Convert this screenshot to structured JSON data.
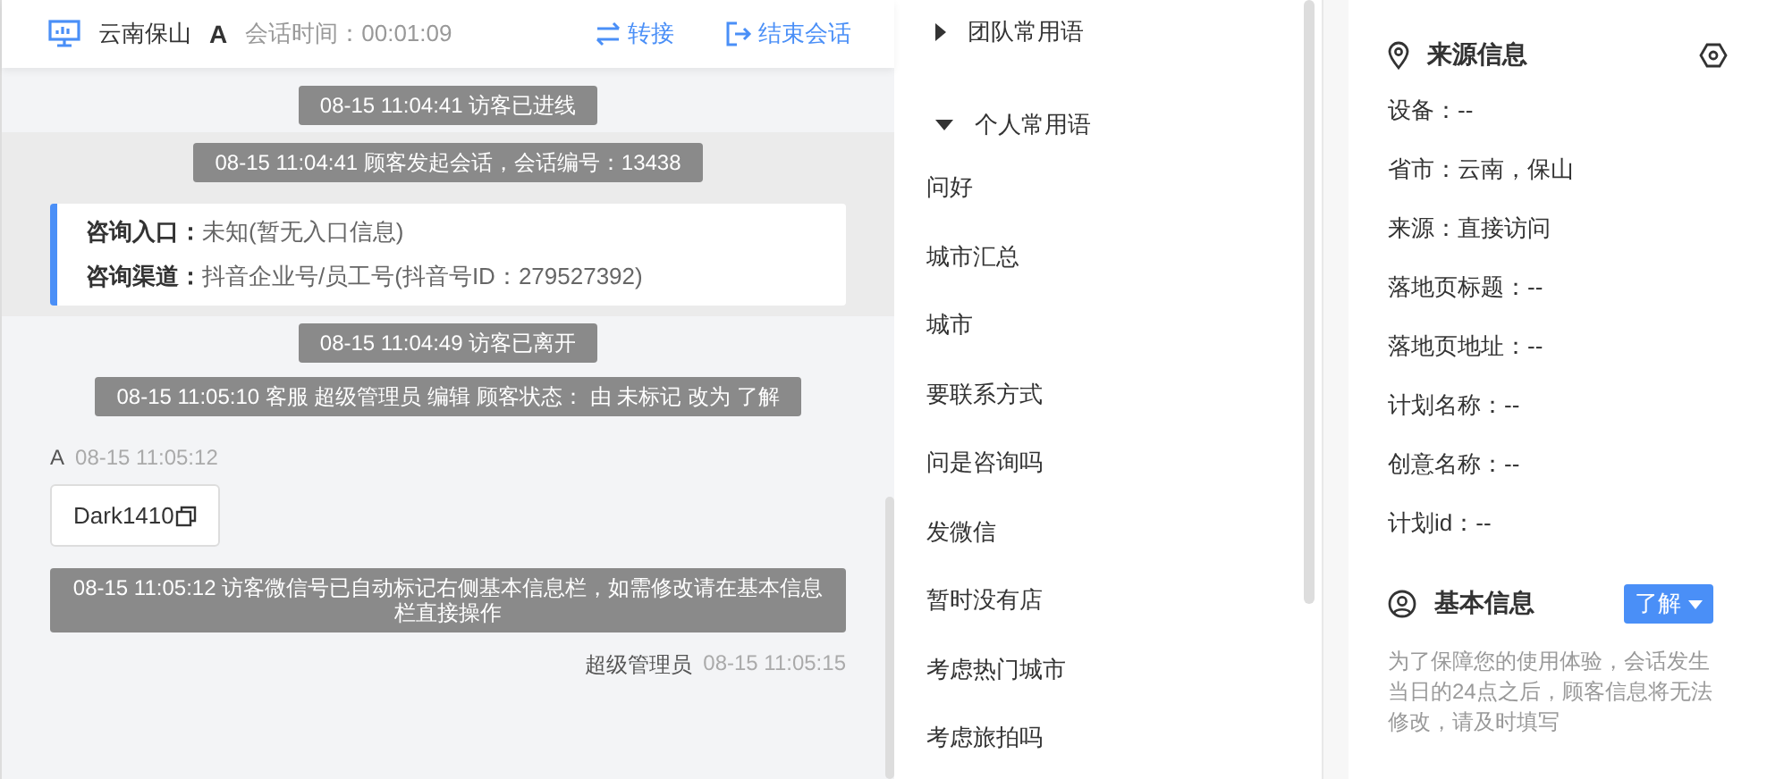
{
  "header": {
    "visitor": "云南保山",
    "visitor_tag": "A",
    "duration": "会话时间：00:01:09",
    "actions": [
      {
        "kind": "transfer",
        "label": "转接"
      },
      {
        "kind": "end",
        "label": "结束会话"
      }
    ]
  },
  "messages": [
    {
      "kind": "system",
      "text": "08-15 11:04:41 访客已进线",
      "highlighted": false
    },
    {
      "kind": "system",
      "text": "08-15 11:04:41 顾客发起会话，会话编号：13438",
      "highlighted": true
    },
    {
      "kind": "info",
      "highlighted": true,
      "rows": [
        {
          "label": "咨询入口：",
          "value": "未知(暂无入口信息)"
        },
        {
          "label": "咨询渠道：",
          "value": "抖音企业号/员工号(抖音号ID：279527392)"
        }
      ]
    },
    {
      "kind": "system",
      "text": "08-15 11:04:49 访客已离开",
      "highlighted": false
    },
    {
      "kind": "system",
      "text": "08-15 11:05:10 客服 超级管理员 编辑 顾客状态： 由 未标记 改为 了解",
      "highlighted": false
    },
    {
      "kind": "visitor",
      "sender": "A",
      "time": "08-15 11:05:12",
      "text": "Dark1410",
      "highlighted": false
    },
    {
      "kind": "system",
      "text": "08-15 11:05:12 访客微信号已自动标记右侧基本信息栏，如需修改请在基本信息栏直接操作",
      "highlighted": false
    },
    {
      "kind": "agent",
      "sender": "超级管理员",
      "time": "08-15 11:05:15",
      "highlighted": false
    }
  ],
  "phrases": [
    {
      "label": "团队常用语",
      "expanded": false
    },
    {
      "label": "个人常用语",
      "expanded": true,
      "items": [
        "问好",
        "城市汇总",
        "城市",
        "要联系方式",
        "问是咨询吗",
        "发微信",
        "暂时没有店",
        "考虑热门城市",
        "考虑旅拍吗"
      ]
    }
  ],
  "source_info": {
    "title": "来源信息",
    "fields": [
      "设备：--",
      "省市：云南，保山",
      "来源：直接访问",
      "落地页标题：--",
      "落地页地址：--",
      "计划名称：--",
      "创意名称：--",
      "计划id：--"
    ]
  },
  "basic_info": {
    "title": "基本信息",
    "status": "了解",
    "note": "为了保障您的使用体验，会话发生当日的24点之后，顾客信息将无法修改，请及时填写"
  }
}
